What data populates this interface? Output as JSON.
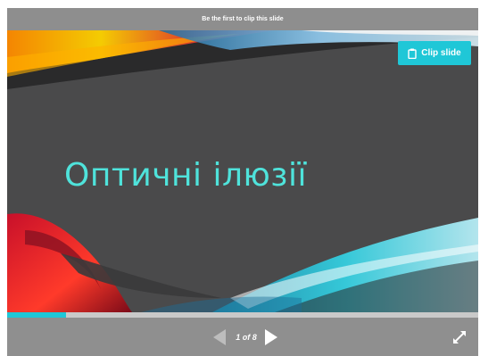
{
  "banner": {
    "text": "Be the first to clip this slide"
  },
  "slide": {
    "title": "Оптичні ілюзії"
  },
  "clip_button": {
    "label": "Clip slide",
    "icon": "clipboard-icon"
  },
  "progress": {
    "fraction": 0.125
  },
  "pager": {
    "counter": "1 of 8",
    "prev_icon": "triangle-left-icon",
    "next_icon": "triangle-right-icon",
    "fullscreen_icon": "expand-arrows-icon"
  },
  "colors": {
    "accent": "#1fc7d7",
    "title": "#4fe3db",
    "slide_background": "#4a4a4b",
    "bar": "#8f8f8f"
  }
}
